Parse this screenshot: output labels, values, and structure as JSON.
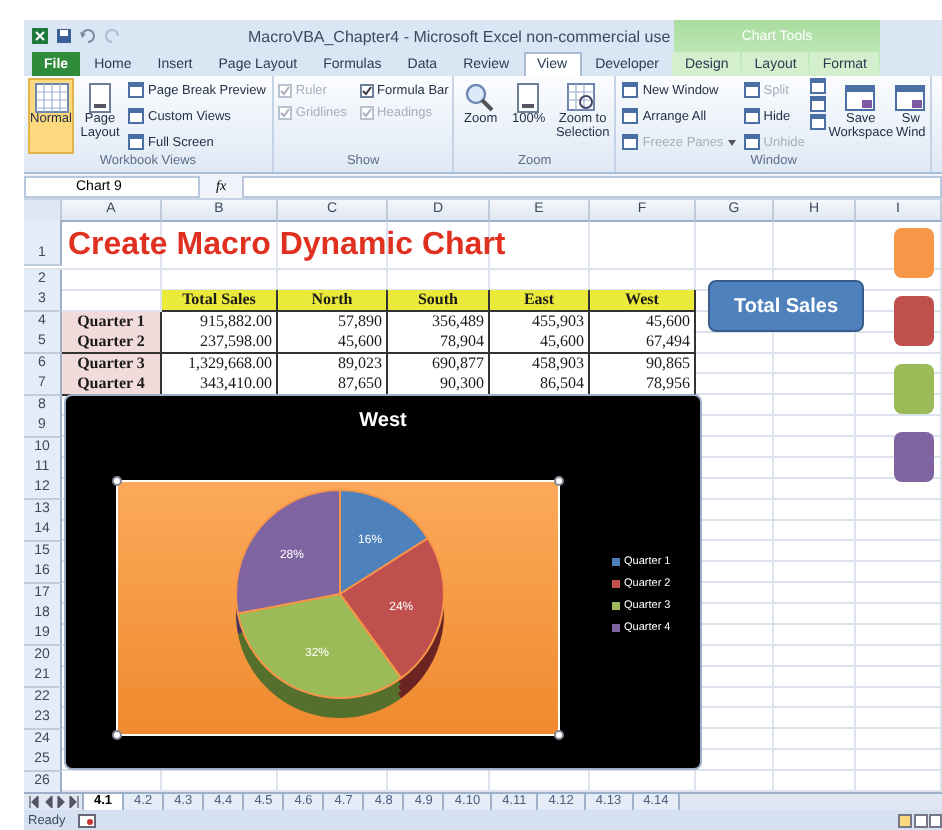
{
  "window": {
    "title": "MacroVBA_Chapter4 - Microsoft Excel non-commercial use",
    "context_group": "Chart Tools"
  },
  "tabs": [
    {
      "label": "File",
      "kind": "file",
      "selected": false
    },
    {
      "label": "Home",
      "kind": "plain",
      "selected": false
    },
    {
      "label": "Insert",
      "kind": "plain",
      "selected": false
    },
    {
      "label": "Page Layout",
      "kind": "plain",
      "selected": false
    },
    {
      "label": "Formulas",
      "kind": "plain",
      "selected": false
    },
    {
      "label": "Data",
      "kind": "plain",
      "selected": false
    },
    {
      "label": "Review",
      "kind": "plain",
      "selected": false
    },
    {
      "label": "View",
      "kind": "plain",
      "selected": true
    },
    {
      "label": "Developer",
      "kind": "plain",
      "selected": false
    },
    {
      "label": "Design",
      "kind": "context",
      "selected": false
    },
    {
      "label": "Layout",
      "kind": "context",
      "selected": false
    },
    {
      "label": "Format",
      "kind": "context",
      "selected": false
    }
  ],
  "ribbon": [
    {
      "kind": "views",
      "label": "Workbook Views",
      "large": [
        {
          "label": "Normal",
          "selected": true
        },
        {
          "label": "Page Layout",
          "selected": false
        }
      ],
      "small": [
        {
          "label": "Page Break Preview",
          "disabled": false
        },
        {
          "label": "Custom Views",
          "disabled": false
        },
        {
          "label": "Full Screen",
          "disabled": false
        }
      ]
    },
    {
      "kind": "show",
      "label": "Show",
      "checks": [
        {
          "label": "Ruler",
          "checked": true,
          "disabled": true
        },
        {
          "label": "Formula Bar",
          "checked": true,
          "disabled": false
        },
        {
          "label": "Gridlines",
          "checked": true,
          "disabled": true
        },
        {
          "label": "Headings",
          "checked": true,
          "disabled": true
        }
      ]
    },
    {
      "kind": "zoom",
      "label": "Zoom",
      "large": [
        {
          "label": "Zoom",
          "selected": false
        },
        {
          "label": "100%",
          "selected": false
        },
        {
          "label": "Zoom to Selection",
          "selected": false
        }
      ]
    },
    {
      "kind": "window",
      "label": "Window",
      "small": [
        {
          "label": "New Window",
          "disabled": false
        },
        {
          "label": "Arrange All",
          "disabled": false
        },
        {
          "label": "Freeze Panes",
          "disabled": true,
          "dropdown": true
        },
        {
          "label": "Split",
          "disabled": true
        },
        {
          "label": "Hide",
          "disabled": false
        },
        {
          "label": "Unhide",
          "disabled": true
        }
      ],
      "large": [
        {
          "label": "Save Workspace",
          "selected": false
        },
        {
          "label": "Sw Wind",
          "selected": false
        }
      ]
    }
  ],
  "formula_bar": {
    "name_box": "Chart 9",
    "function_label": "fx"
  },
  "sheet": {
    "columns": [
      "A",
      "B",
      "C",
      "D",
      "E",
      "F",
      "G",
      "H",
      "I"
    ],
    "rows": [
      {
        "number": "1",
        "cells": [
          {
            "kind": "title",
            "text": "Create Macro Dynamic Chart"
          }
        ]
      },
      {
        "number": "2"
      },
      {
        "number": "3",
        "cells": [
          {
            "kind": "blank"
          },
          {
            "kind": "header",
            "text": "Total Sales"
          },
          {
            "kind": "header",
            "text": "North"
          },
          {
            "kind": "header",
            "text": "South"
          },
          {
            "kind": "header",
            "text": "East"
          },
          {
            "kind": "header",
            "text": "West"
          }
        ]
      },
      {
        "number": "4",
        "cells": [
          {
            "kind": "label",
            "text": "Quarter 1"
          },
          {
            "kind": "number",
            "text": "915,882.00"
          },
          {
            "kind": "number",
            "text": "57,890"
          },
          {
            "kind": "number",
            "text": "356,489"
          },
          {
            "kind": "number",
            "text": "455,903"
          },
          {
            "kind": "number",
            "text": "45,600"
          }
        ]
      },
      {
        "number": "5",
        "cells": [
          {
            "kind": "label",
            "text": "Quarter 2"
          },
          {
            "kind": "number",
            "text": "237,598.00"
          },
          {
            "kind": "number",
            "text": "45,600"
          },
          {
            "kind": "number",
            "text": "78,904"
          },
          {
            "kind": "number",
            "text": "45,600"
          },
          {
            "kind": "number",
            "text": "67,494"
          }
        ]
      },
      {
        "number": "6",
        "cells": [
          {
            "kind": "label",
            "text": "Quarter 3"
          },
          {
            "kind": "number",
            "text": "1,329,668.00"
          },
          {
            "kind": "number",
            "text": "89,023"
          },
          {
            "kind": "number",
            "text": "690,877"
          },
          {
            "kind": "number",
            "text": "458,903"
          },
          {
            "kind": "number",
            "text": "90,865"
          }
        ]
      },
      {
        "number": "7",
        "cells": [
          {
            "kind": "label",
            "text": "Quarter 4"
          },
          {
            "kind": "number",
            "text": "343,410.00"
          },
          {
            "kind": "number",
            "text": "87,650"
          },
          {
            "kind": "number",
            "text": "90,300"
          },
          {
            "kind": "number",
            "text": "86,504"
          },
          {
            "kind": "number",
            "text": "78,956"
          }
        ]
      },
      {
        "number": "8"
      },
      {
        "number": "9"
      },
      {
        "number": "10"
      },
      {
        "number": "11"
      },
      {
        "number": "12"
      },
      {
        "number": "13"
      },
      {
        "number": "14"
      },
      {
        "number": "15"
      },
      {
        "number": "16"
      },
      {
        "number": "17"
      },
      {
        "number": "18"
      },
      {
        "number": "19"
      },
      {
        "number": "20"
      },
      {
        "number": "21"
      },
      {
        "number": "22"
      },
      {
        "number": "23"
      },
      {
        "number": "24"
      },
      {
        "number": "25"
      },
      {
        "number": "26"
      }
    ]
  },
  "chart": {
    "chart_data": {
      "type": "pie",
      "title": "West",
      "categories": [
        "Quarter 1",
        "Quarter 2",
        "Quarter 3",
        "Quarter 4"
      ],
      "values": [
        16,
        24,
        32,
        28
      ],
      "value_labels": [
        "16%",
        "24%",
        "32%",
        "28%"
      ]
    }
  },
  "macro_buttons": [
    {
      "label": "Total Sales",
      "color": "#4f81bd"
    }
  ],
  "side_buttons": [
    {
      "color": "#f79646"
    },
    {
      "color": "#c0504d"
    },
    {
      "color": "#9bbb59"
    },
    {
      "color": "#8064a2"
    }
  ],
  "sheet_tabs": [
    {
      "label": "4.1",
      "selected": true
    },
    {
      "label": "4.2",
      "selected": false
    },
    {
      "label": "4.3",
      "selected": false
    },
    {
      "label": "4.4",
      "selected": false
    },
    {
      "label": "4.5",
      "selected": false
    },
    {
      "label": "4.6",
      "selected": false
    },
    {
      "label": "4.7",
      "selected": false
    },
    {
      "label": "4.8",
      "selected": false
    },
    {
      "label": "4.9",
      "selected": false
    },
    {
      "label": "4.10",
      "selected": false
    },
    {
      "label": "4.11",
      "selected": false
    },
    {
      "label": "4.12",
      "selected": false
    },
    {
      "label": "4.13",
      "selected": false
    },
    {
      "label": "4.14",
      "selected": false
    }
  ],
  "status_bar": {
    "text": "Ready"
  }
}
